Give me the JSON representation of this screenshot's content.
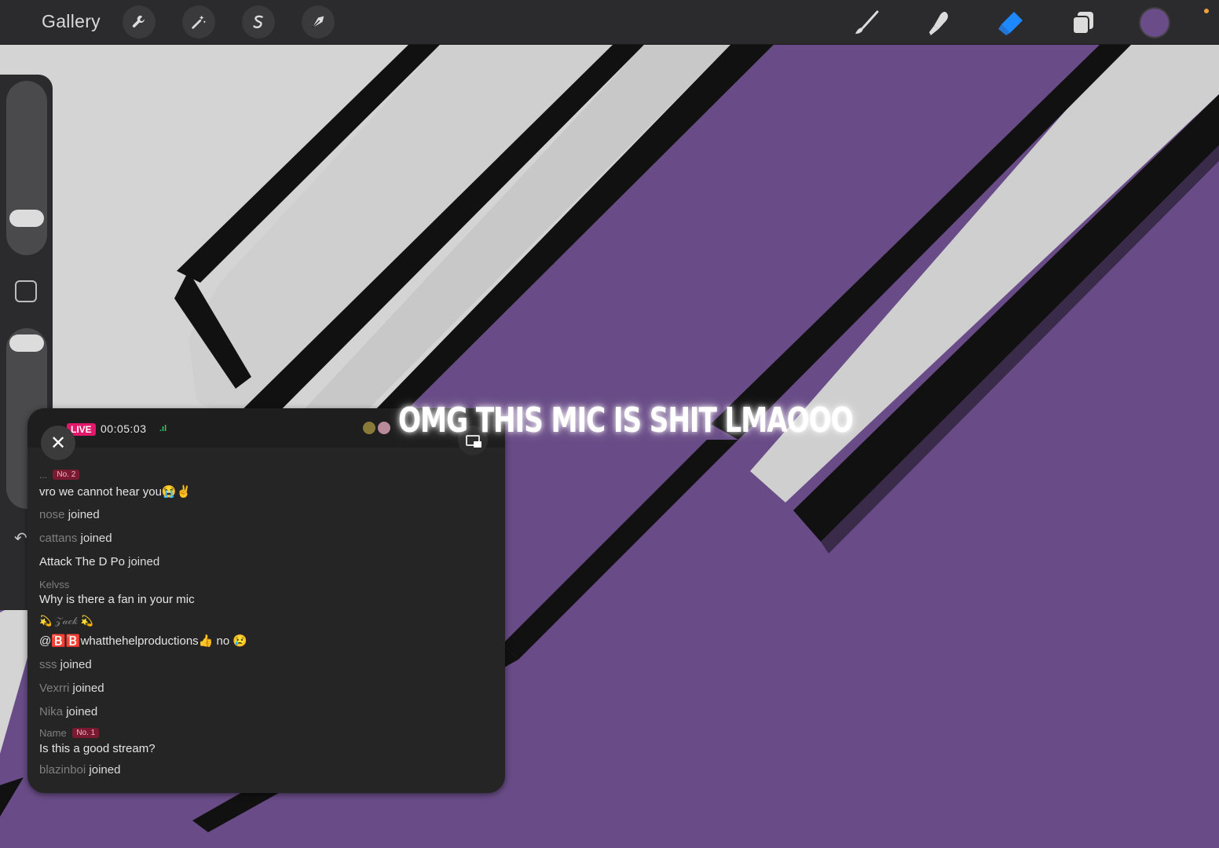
{
  "topbar": {
    "gallery_label": "Gallery",
    "left_tools": [
      "wrench-icon",
      "magic-wand-icon",
      "selection-s-icon",
      "transform-arrow-icon"
    ],
    "right_tools": [
      "brush-icon",
      "smudge-icon",
      "eraser-icon",
      "layers-icon",
      "color-swatch-icon"
    ],
    "active_tool": "eraser-icon",
    "current_color": "#6a4c88",
    "accent_color": "#1e88ff"
  },
  "sidebar": {
    "size_slider_value": 0.27,
    "opacity_slider_value": 1.0,
    "modify_button_icon": "square-icon",
    "undo_icon": "undo-icon"
  },
  "caption": {
    "text": "OMG THIS MIC IS SHIT LMAOOO"
  },
  "live_chat": {
    "live_badge": "LIVE",
    "timer": "00:05:03",
    "signal_icon": "signal-bars-icon",
    "close_icon": "close-icon",
    "pip_icon": "picture-in-picture-icon",
    "messages": [
      {
        "user": "...",
        "badge": "No. 2",
        "text": "vro we cannot hear you😭✌️"
      },
      {
        "user": "nose",
        "text": "joined"
      },
      {
        "user": "cattans",
        "text": "joined"
      },
      {
        "user": "Attack The D Po",
        "text": "joined"
      },
      {
        "user": "Kelvss",
        "text": "Why is there a fan in your mic"
      },
      {
        "user": "💫 𝒵𝒶𝒸𝓀 💫",
        "text": "@🅱️🅱️whatthehelproductions👍 no 😢"
      },
      {
        "user": "sss",
        "text": "joined"
      },
      {
        "user": "Vexrri",
        "text": "joined"
      },
      {
        "user": "Nika",
        "text": "joined"
      },
      {
        "user": "Name",
        "badge": "No. 1",
        "text": "Is this a good stream?"
      },
      {
        "user": "blazinboi",
        "text": "joined"
      }
    ]
  }
}
